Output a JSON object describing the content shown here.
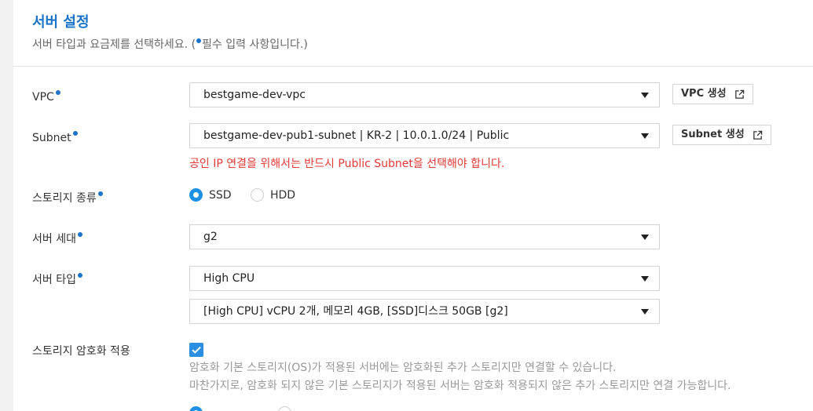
{
  "header": {
    "title": "서버 설정",
    "subtitle_before": "서버 타입과 요금제를 선택하세요. (",
    "subtitle_after": "필수 입력 사항입니다.)"
  },
  "vpc": {
    "label": "VPC",
    "value": "bestgame-dev-vpc",
    "button_label": "VPC 생성"
  },
  "subnet": {
    "label": "Subnet",
    "value": "bestgame-dev-pub1-subnet | KR-2 | 10.0.1.0/24 | Public",
    "button_label": "Subnet 생성",
    "warning": "공인 IP 연결을 위해서는 반드시 Public Subnet을 선택해야 합니다."
  },
  "storage_type": {
    "label": "스토리지 종류",
    "options": [
      "SSD",
      "HDD"
    ],
    "selected": "SSD"
  },
  "server_generation": {
    "label": "서버 세대",
    "value": "g2"
  },
  "server_type": {
    "label": "서버 타입",
    "value": "High CPU",
    "spec_value": "[High CPU] vCPU 2개, 메모리 4GB, [SSD]디스크 50GB [g2]"
  },
  "storage_encryption": {
    "label": "스토리지 암호화 적용",
    "checked": true,
    "help_line1": "암호화 기본 스토리지(OS)가 적용된 서버에는 암호화된 추가 스토리지만 연결할 수 있습니다.",
    "help_line2": "마찬가지로, 암호화 되지 않은 기본 스토리지가 적용된 서버는 암호화 적용되지 않은 추가 스토리지만 연결 가능합니다."
  },
  "colors": {
    "accent": "#1a73c9",
    "radio_selected": "#1e90e6",
    "warning": "#e53935",
    "checkbox": "#2a8fe0"
  }
}
